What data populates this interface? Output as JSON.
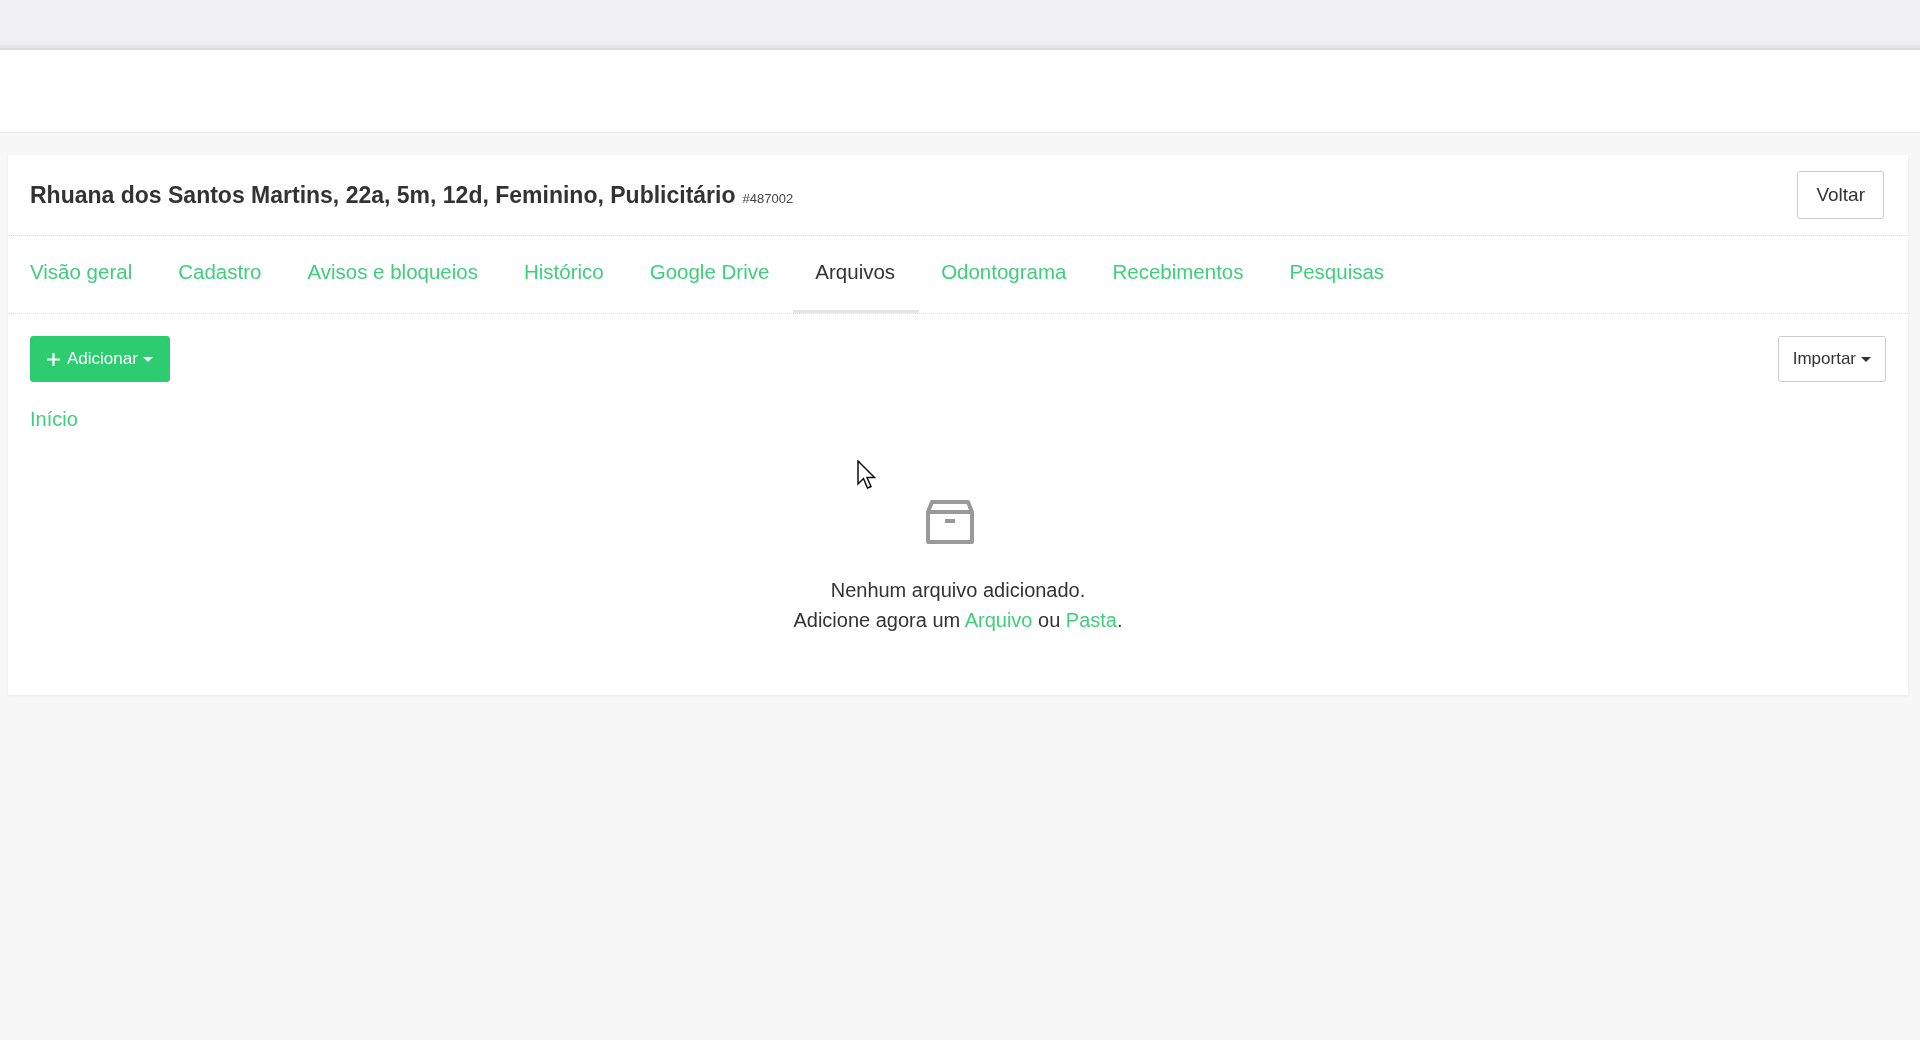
{
  "patient": {
    "title": "Rhuana dos Santos Martins, 22a, 5m, 12d, Feminino, Publicitário",
    "id": "#487002"
  },
  "back_button": "Voltar",
  "tabs": [
    {
      "label": "Visão geral",
      "selected": false
    },
    {
      "label": "Cadastro",
      "selected": false
    },
    {
      "label": "Avisos e bloqueios",
      "selected": false
    },
    {
      "label": "Histórico",
      "selected": false
    },
    {
      "label": "Google Drive",
      "selected": false
    },
    {
      "label": "Arquivos",
      "selected": true
    },
    {
      "label": "Odontograma",
      "selected": false
    },
    {
      "label": "Recebimentos",
      "selected": false
    },
    {
      "label": "Pesquisas",
      "selected": false
    }
  ],
  "add_button": "Adicionar",
  "import_button": "Importar",
  "breadcrumb": "Início",
  "empty_state": {
    "message": "Nenhum arquivo adicionado.",
    "hint": [
      {
        "kind": "text",
        "text": "Adicione agora um "
      },
      {
        "kind": "link",
        "text": "Arquivo"
      },
      {
        "kind": "text",
        "text": " ou "
      },
      {
        "kind": "link",
        "text": "Pasta"
      },
      {
        "kind": "text",
        "text": "."
      }
    ]
  }
}
